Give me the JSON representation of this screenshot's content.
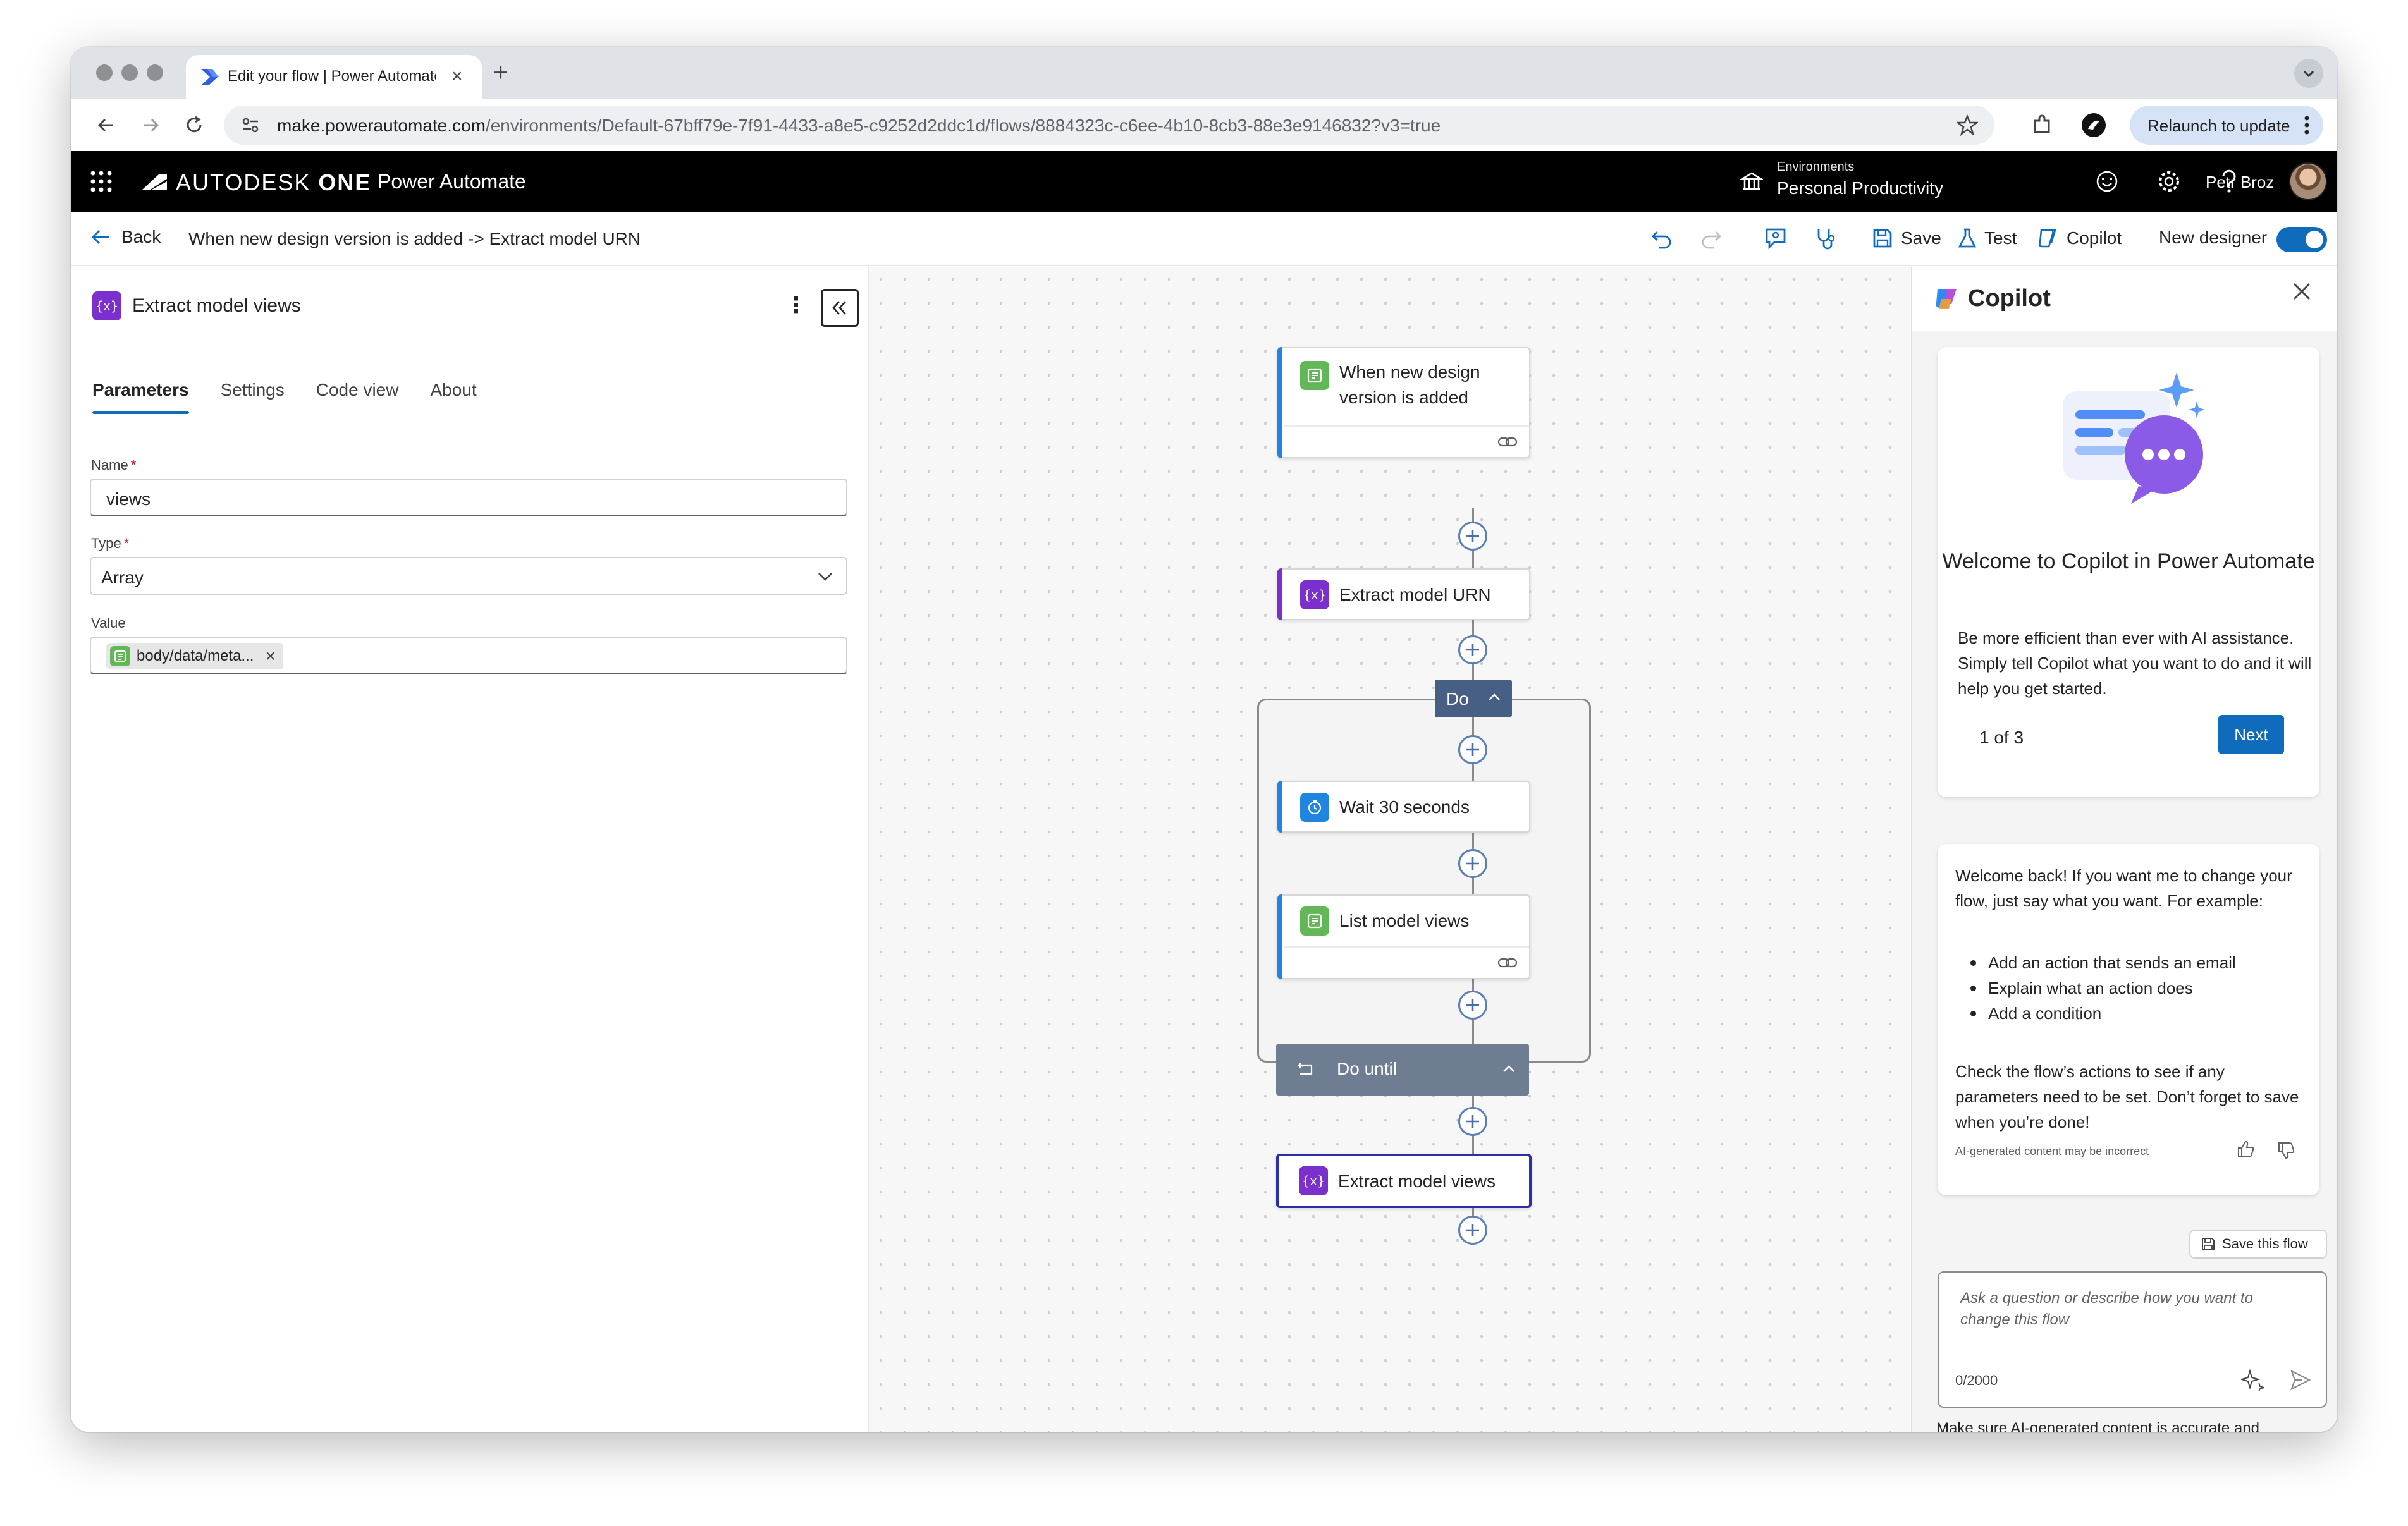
{
  "browser": {
    "tab_title": "Edit your flow | Power Automate",
    "url_host": "make.powerautomate.com",
    "url_path": "/environments/Default-67bff79e-7f91-4433-a8e5-c9252d2ddc1d/flows/8884323c-c6ee-4b10-8cb3-88e3e9146832?v3=true",
    "relaunch_label": "Relaunch to update"
  },
  "appbar": {
    "brand_light": "AUTODESK",
    "brand_bold": "ONE",
    "product": "Power Automate",
    "env_label": "Environments",
    "env_name": "Personal Productivity",
    "user_name": "Petr Broz"
  },
  "command_bar": {
    "back_label": "Back",
    "flow_name": "When new design version is added -> Extract model URN",
    "save_label": "Save",
    "test_label": "Test",
    "copilot_label": "Copilot",
    "new_designer_label": "New designer",
    "new_designer_on": true
  },
  "action_panel": {
    "title": "Extract model views",
    "icon_text": "{x}",
    "tabs": [
      "Parameters",
      "Settings",
      "Code view",
      "About"
    ],
    "active_tab": "Parameters",
    "name_label": "Name",
    "name_value": "views",
    "type_label": "Type",
    "type_value": "Array",
    "value_label": "Value",
    "value_token": "body/data/meta..."
  },
  "canvas": {
    "trigger_title": "When new design version is added",
    "extract_urn_title": "Extract model URN",
    "do_label": "Do",
    "wait_title": "Wait 30 seconds",
    "list_views_title": "List model views",
    "do_until_label": "Do until",
    "extract_views_title": "Extract model views",
    "var_icon_text": "{x}"
  },
  "copilot": {
    "title": "Copilot",
    "welcome_title": "Welcome to Copilot in Power Automate",
    "welcome_text": "Be more efficient than ever with AI assistance. Simply tell Copilot what you want to do and it will help you get started.",
    "pager": "1 of 3",
    "next_label": "Next",
    "message_intro": "Welcome back! If you want me to change your flow, just say what you want. For example:",
    "message_examples": [
      "Add an action that sends an email",
      "Explain what an action does",
      "Add a condition"
    ],
    "message_outro": "Check the flow’s actions to see if any parameters need to be set. Don’t forget to save when you’re done!",
    "disclaimer": "AI-generated content may be incorrect",
    "save_flow_label": "Save this flow",
    "prompt_placeholder": "Ask a question or describe how you want to change this flow",
    "counter": "0/2000",
    "footer_note": "Make sure AI-generated content is accurate and appropriate before using."
  },
  "colors": {
    "accent": "#0f6cbd",
    "variable_icon": "#7b2fcc",
    "connector_icon": "#62b856",
    "delay_icon": "#1f85de",
    "scope_header": "#475f84",
    "do_until_header": "#6e7d92",
    "selected_border": "#2a2fa8"
  }
}
